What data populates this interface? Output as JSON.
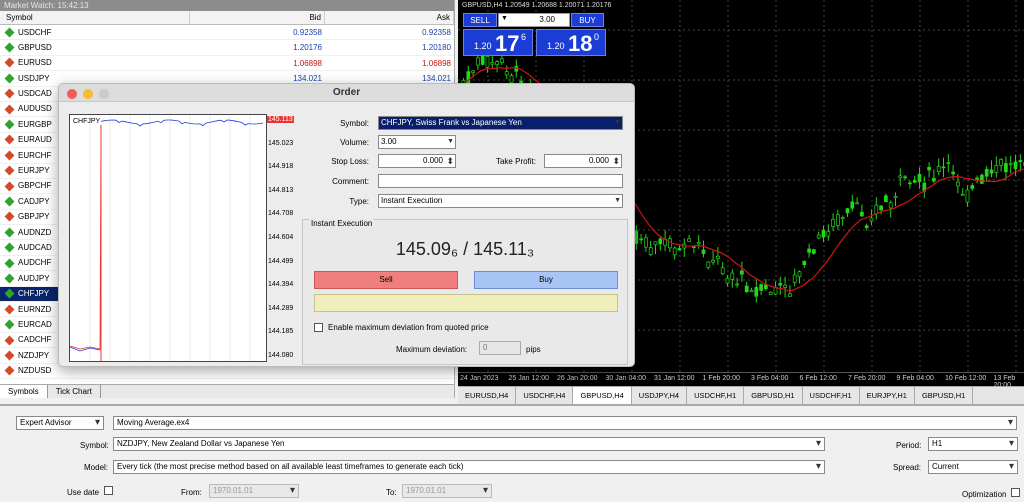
{
  "market_watch": {
    "title": "Market Watch: 15:42:13",
    "headers": {
      "symbol": "Symbol",
      "bid": "Bid",
      "ask": "Ask"
    },
    "rows": [
      {
        "symbol": "USDCHF",
        "bid": "0.92358",
        "ask": "0.92358",
        "dir": "up"
      },
      {
        "symbol": "GBPUSD",
        "bid": "1.20176",
        "ask": "1.20180",
        "dir": "up"
      },
      {
        "symbol": "EURUSD",
        "bid": "1.06898",
        "ask": "1.06898",
        "dir": "dn",
        "red": true
      },
      {
        "symbol": "USDJPY",
        "bid": "134.021",
        "ask": "134.021",
        "dir": "up"
      },
      {
        "symbol": "USDCAD",
        "bid": "",
        "ask": "",
        "dir": "dn"
      },
      {
        "symbol": "AUDUSD",
        "bid": "",
        "ask": "",
        "dir": "dn"
      },
      {
        "symbol": "EURGBP",
        "bid": "",
        "ask": "",
        "dir": "up"
      },
      {
        "symbol": "EURAUD",
        "bid": "",
        "ask": "",
        "dir": "dn"
      },
      {
        "symbol": "EURCHF",
        "bid": "",
        "ask": "",
        "dir": "dn"
      },
      {
        "symbol": "EURJPY",
        "bid": "",
        "ask": "",
        "dir": "dn"
      },
      {
        "symbol": "GBPCHF",
        "bid": "",
        "ask": "",
        "dir": "dn"
      },
      {
        "symbol": "CADJPY",
        "bid": "",
        "ask": "",
        "dir": "up"
      },
      {
        "symbol": "GBPJPY",
        "bid": "",
        "ask": "",
        "dir": "dn"
      },
      {
        "symbol": "AUDNZD",
        "bid": "",
        "ask": "",
        "dir": "up"
      },
      {
        "symbol": "AUDCAD",
        "bid": "",
        "ask": "",
        "dir": "up"
      },
      {
        "symbol": "AUDCHF",
        "bid": "",
        "ask": "",
        "dir": "up"
      },
      {
        "symbol": "AUDJPY",
        "bid": "",
        "ask": "",
        "dir": "up"
      },
      {
        "symbol": "CHFJPY",
        "bid": "",
        "ask": "",
        "dir": "up",
        "selected": true
      },
      {
        "symbol": "EURNZD",
        "bid": "",
        "ask": "",
        "dir": "dn"
      },
      {
        "symbol": "EURCAD",
        "bid": "",
        "ask": "",
        "dir": "up"
      },
      {
        "symbol": "CADCHF",
        "bid": "",
        "ask": "",
        "dir": "dn"
      },
      {
        "symbol": "NZDJPY",
        "bid": "",
        "ask": "",
        "dir": "dn"
      },
      {
        "symbol": "NZDUSD",
        "bid": "",
        "ask": "",
        "dir": "dn"
      }
    ],
    "tabs": [
      "Symbols",
      "Tick Chart"
    ]
  },
  "chart": {
    "title": "GBPUSD,H4  1.20549 1.20688 1.20071 1.20176",
    "one_click": {
      "sell": "SELL",
      "buy": "BUY",
      "lot": "3.00",
      "sell_small": "1.20",
      "sell_big": "17",
      "sell_sup": "6",
      "buy_small": "1.20",
      "buy_big": "18",
      "buy_sup": "0"
    },
    "x_labels": [
      "24 Jan 2023",
      "25 Jan 12:00",
      "26 Jan 20:00",
      "30 Jan 04:00",
      "31 Jan 12:00",
      "1 Feb 20:00",
      "3 Feb 04:00",
      "6 Feb 12:00",
      "7 Feb 20:00",
      "9 Feb 04:00",
      "10 Feb 12:00",
      "13 Feb 20:00"
    ],
    "tabs": [
      "EURUSD,H4",
      "USDCHF,H4",
      "GBPUSD,H4",
      "USDJPY,H4",
      "USDCHF,H1",
      "GBPUSD,H1",
      "USDCHF,H1",
      "EURJPY,H1",
      "GBPUSD,H1"
    ],
    "active_tab": 2
  },
  "order": {
    "title": "Order",
    "mini_symbol": "CHFJPY",
    "mini_axis": [
      "145.113",
      "145.023",
      "144.918",
      "144.813",
      "144.708",
      "144.604",
      "144.499",
      "144.394",
      "144.289",
      "144.185",
      "144.080"
    ],
    "symbol_label": "Symbol:",
    "symbol_value": "CHFJPY, Swiss Frank vs Japanese Yen",
    "volume_label": "Volume:",
    "volume_value": "3.00",
    "sl_label": "Stop Loss:",
    "sl_value": "0.000",
    "tp_label": "Take Profit:",
    "tp_value": "0.000",
    "comment_label": "Comment:",
    "comment_value": "",
    "type_label": "Type:",
    "type_value": "Instant Execution",
    "group_title": "Instant Execution",
    "price_text": "145.09₆ / 145.11₃",
    "sell_label": "Sell",
    "buy_label": "Buy",
    "maxdev_check_label": "Enable maximum deviation from quoted price",
    "maxdev_label": "Maximum deviation:",
    "maxdev_value": "0",
    "pips": "pips"
  },
  "tester": {
    "type_value": "Expert Advisor",
    "ea_value": "Moving Average.ex4",
    "symbol_label": "Symbol:",
    "symbol_value": "NZDJPY, New Zealand Dollar vs Japanese Yen",
    "model_label": "Model:",
    "model_value": "Every tick (the most precise method based on all available least timeframes to generate each tick)",
    "period_label": "Period:",
    "period_value": "H1",
    "spread_label": "Spread:",
    "spread_value": "Current",
    "usedate_label": "Use date",
    "from_label": "From:",
    "from_value": "1970.01.01",
    "to_label": "To:",
    "to_value": "1970.01.01",
    "optimization_label": "Optimization"
  },
  "colors": {
    "bull": "#25d61a",
    "ma": "#d21414",
    "one_click_blue": "#1b3dd6",
    "selected_row": "#0b246a"
  }
}
